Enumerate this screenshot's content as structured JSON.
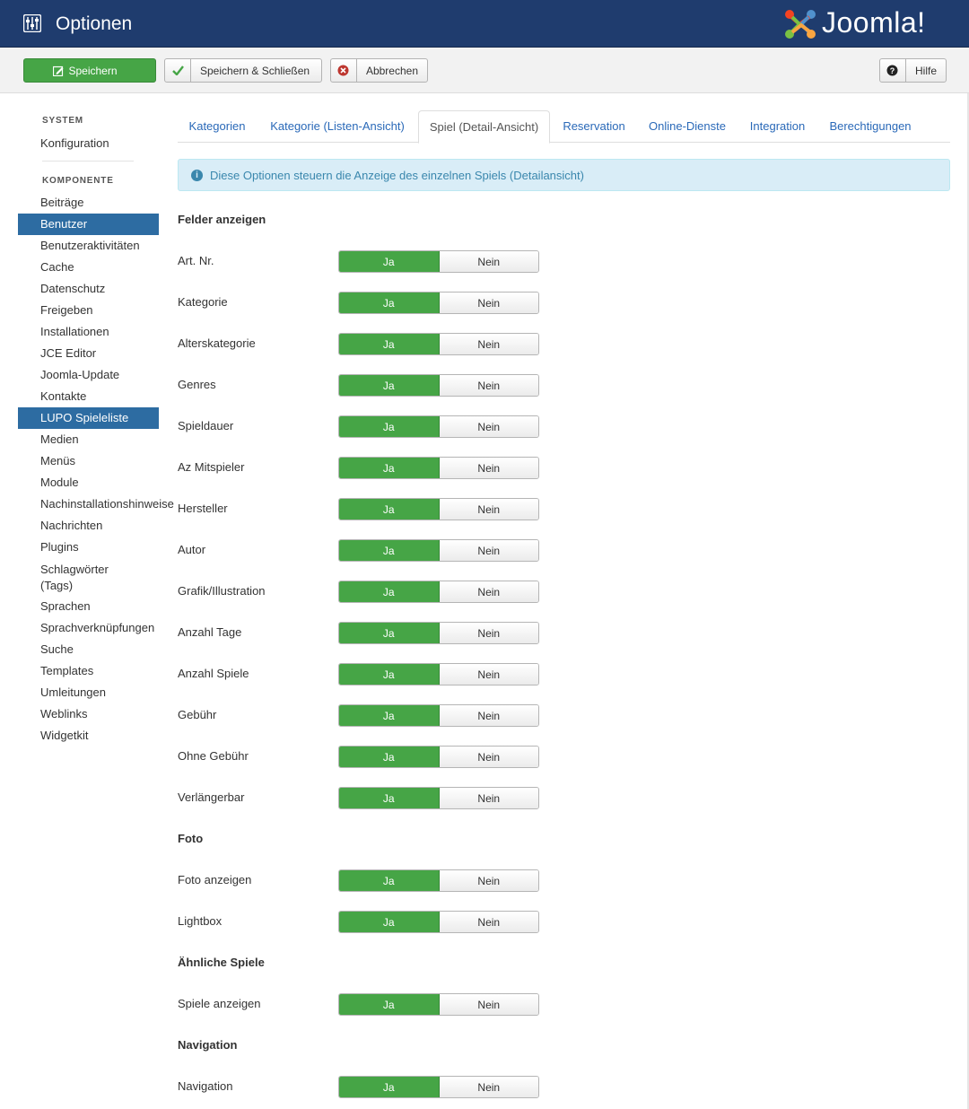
{
  "header": {
    "title": "Optionen",
    "logo_text": "Joomla!"
  },
  "toolbar": {
    "save": "Speichern",
    "save_close": "Speichern & Schließen",
    "cancel": "Abbrechen",
    "help": "Hilfe"
  },
  "sidebar": {
    "system_heading": "SYSTEM",
    "system_items": [
      "Konfiguration"
    ],
    "component_heading": "KOMPONENTE",
    "component_items": [
      {
        "label": "Beiträge",
        "active": false
      },
      {
        "label": "Benutzer",
        "active": true
      },
      {
        "label": "Benutzeraktivitäten",
        "active": false
      },
      {
        "label": "Cache",
        "active": false
      },
      {
        "label": "Datenschutz",
        "active": false
      },
      {
        "label": "Freigeben",
        "active": false
      },
      {
        "label": "Installationen",
        "active": false
      },
      {
        "label": "JCE Editor",
        "active": false
      },
      {
        "label": "Joomla-Update",
        "active": false
      },
      {
        "label": "Kontakte",
        "active": false
      },
      {
        "label": "LUPO Spieleliste",
        "active": true
      },
      {
        "label": "Medien",
        "active": false
      },
      {
        "label": "Menüs",
        "active": false
      },
      {
        "label": "Module",
        "active": false
      },
      {
        "label": "Nachinstallationshinweise",
        "active": false
      },
      {
        "label": "Nachrichten",
        "active": false
      },
      {
        "label": "Plugins",
        "active": false
      },
      {
        "label": "Schlagwörter (Tags)",
        "active": false
      },
      {
        "label": "Sprachen",
        "active": false
      },
      {
        "label": "Sprachverknüpfungen",
        "active": false
      },
      {
        "label": "Suche",
        "active": false
      },
      {
        "label": "Templates",
        "active": false
      },
      {
        "label": "Umleitungen",
        "active": false
      },
      {
        "label": "Weblinks",
        "active": false
      },
      {
        "label": "Widgetkit",
        "active": false
      }
    ]
  },
  "tabs": [
    {
      "label": "Kategorien",
      "active": false
    },
    {
      "label": "Kategorie (Listen-Ansicht)",
      "active": false
    },
    {
      "label": "Spiel (Detail-Ansicht)",
      "active": true
    },
    {
      "label": "Reservation",
      "active": false
    },
    {
      "label": "Online-Dienste",
      "active": false
    },
    {
      "label": "Integration",
      "active": false
    },
    {
      "label": "Berechtigungen",
      "active": false
    }
  ],
  "alert": "Diese Optionen steuern die Anzeige des einzelnen Spiels (Detailansicht)",
  "toggle_labels": {
    "yes": "Ja",
    "no": "Nein"
  },
  "sections": [
    {
      "title": "Felder anzeigen",
      "fields": [
        {
          "label": "Art. Nr.",
          "value": "Ja"
        },
        {
          "label": "Kategorie",
          "value": "Ja"
        },
        {
          "label": "Alterskategorie",
          "value": "Ja"
        },
        {
          "label": "Genres",
          "value": "Ja"
        },
        {
          "label": "Spieldauer",
          "value": "Ja"
        },
        {
          "label": "Az Mitspieler",
          "value": "Ja"
        },
        {
          "label": "Hersteller",
          "value": "Ja"
        },
        {
          "label": "Autor",
          "value": "Ja"
        },
        {
          "label": "Grafik/Illustration",
          "value": "Ja"
        },
        {
          "label": "Anzahl Tage",
          "value": "Ja"
        },
        {
          "label": "Anzahl Spiele",
          "value": "Ja"
        },
        {
          "label": "Gebühr",
          "value": "Ja"
        },
        {
          "label": "Ohne Gebühr",
          "value": "Ja"
        },
        {
          "label": "Verlängerbar",
          "value": "Ja"
        }
      ]
    },
    {
      "title": "Foto",
      "fields": [
        {
          "label": "Foto anzeigen",
          "value": "Ja"
        },
        {
          "label": "Lightbox",
          "value": "Ja"
        }
      ]
    },
    {
      "title": "Ähnliche Spiele",
      "fields": [
        {
          "label": "Spiele anzeigen",
          "value": "Ja"
        }
      ]
    },
    {
      "title": "Navigation",
      "fields": [
        {
          "label": "Navigation",
          "value": "Ja"
        }
      ]
    }
  ],
  "colors": {
    "header_bg": "#1f3c6e",
    "active_nav": "#2d6ca2",
    "toggle_on": "#46a546",
    "link": "#2a69b8"
  }
}
